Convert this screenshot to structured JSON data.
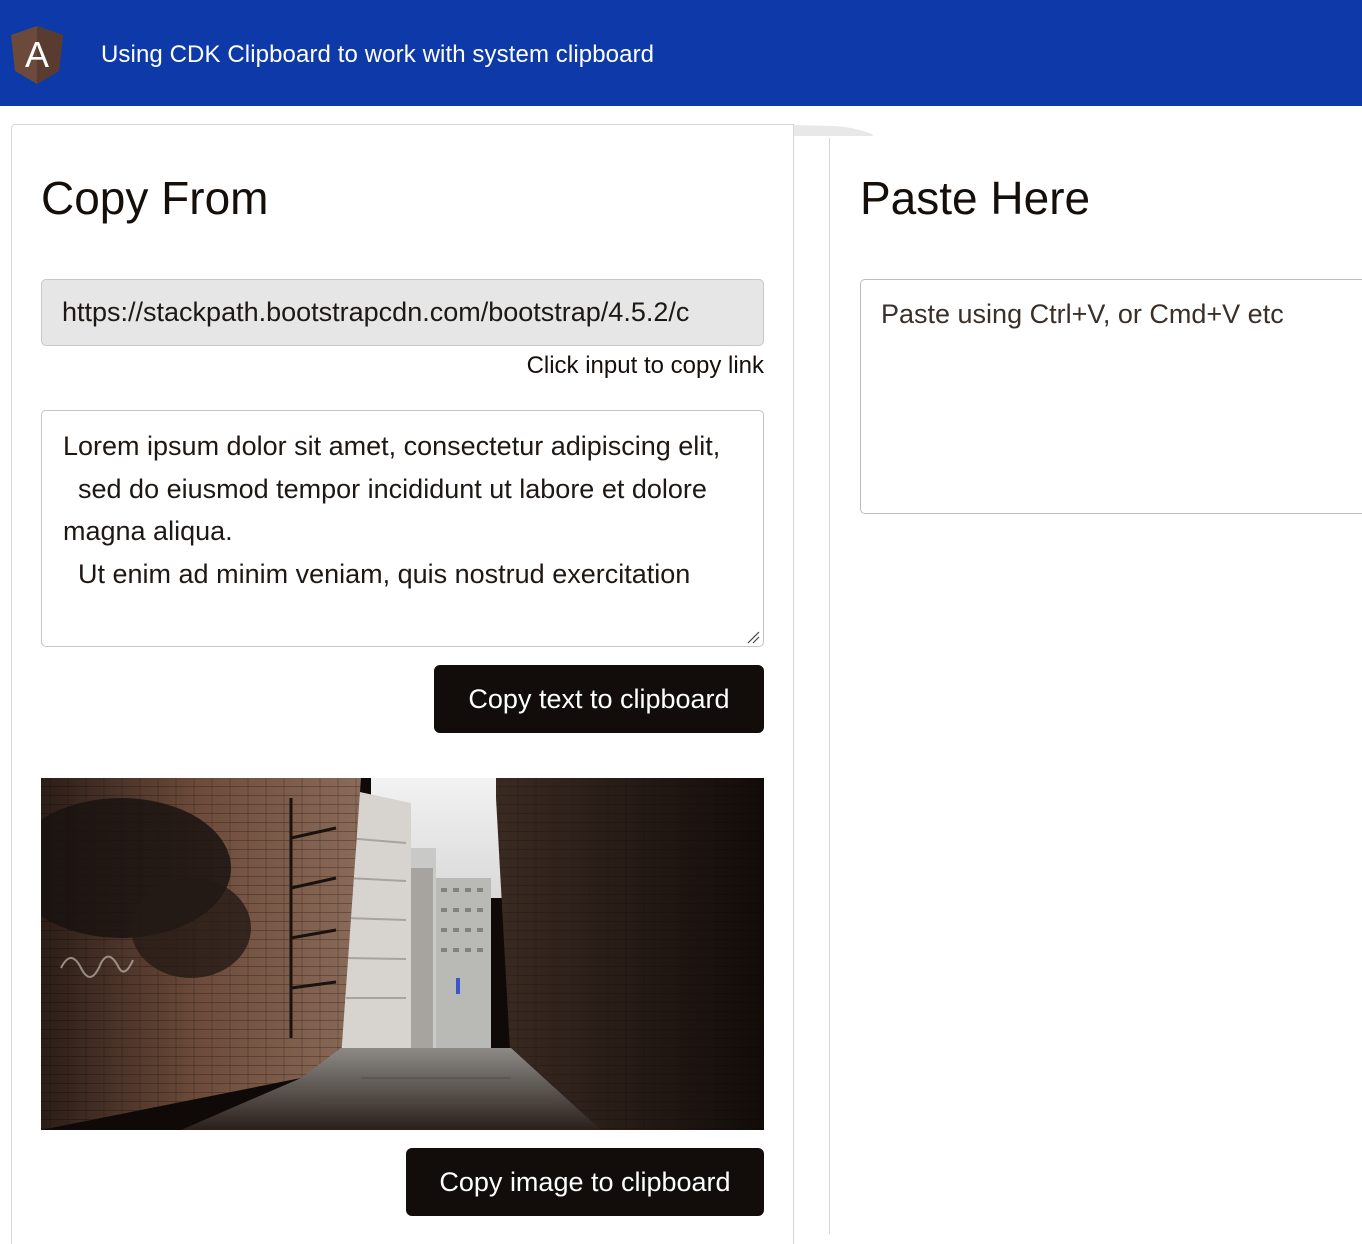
{
  "header": {
    "title": "Using CDK Clipboard to work with system clipboard",
    "logo_icon": "angular-logo-icon",
    "logo_letter": "A",
    "background_color": "#0d3aa8"
  },
  "copy_panel": {
    "heading": "Copy From",
    "link_input_value": "https://stackpath.bootstrapcdn.com/bootstrap/4.5.2/c",
    "link_hint": "Click input to copy link",
    "textarea_value": "Lorem ipsum dolor sit amet, consectetur adipiscing elit,\n  sed do eiusmod tempor incididunt ut labore et dolore magna aliqua.\n  Ut enim ad minim veniam, quis nostrud exercitation",
    "copy_text_button": "Copy text to clipboard",
    "image_subject": "alley-photo",
    "copy_image_button": "Copy image to clipboard"
  },
  "paste_panel": {
    "heading": "Paste Here",
    "placeholder": "Paste using Ctrl+V, or Cmd+V etc"
  },
  "colors": {
    "button_bg": "#120d0b",
    "input_readonly_bg": "#e6e6e6"
  }
}
